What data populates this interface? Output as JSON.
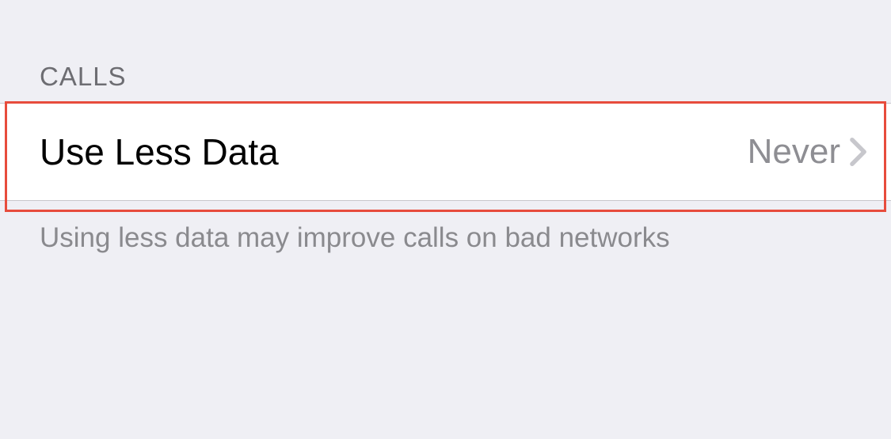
{
  "section": {
    "header": "CALLS",
    "footer": "Using less data may improve calls on bad networks"
  },
  "row": {
    "label": "Use Less Data",
    "value": "Never"
  }
}
